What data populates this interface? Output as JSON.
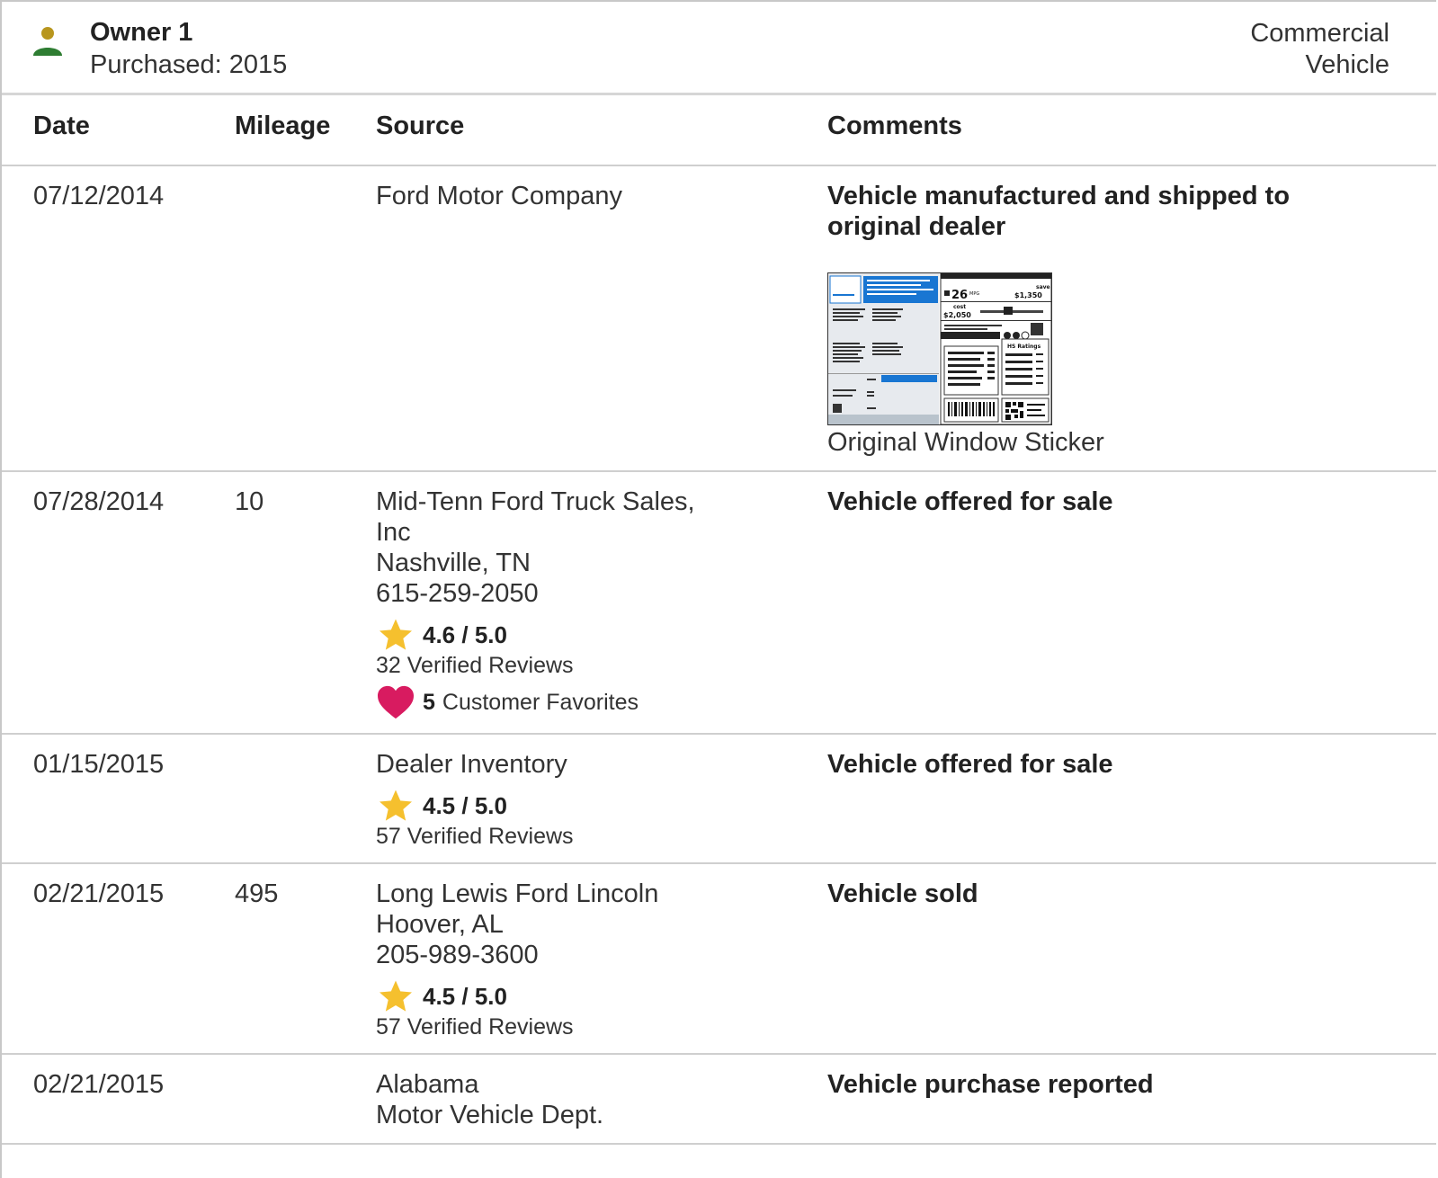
{
  "owner": {
    "name": "Owner 1",
    "purchased": "Purchased: 2015",
    "type_line1": "Commercial",
    "type_line2": "Vehicle"
  },
  "table": {
    "headers": {
      "date": "Date",
      "mileage": "Mileage",
      "source": "Source",
      "comments": "Comments"
    },
    "rows": [
      {
        "date": "07/12/2014",
        "mileage": "",
        "source": [
          "Ford Motor Company"
        ],
        "comment": "Vehicle manufactured and shipped to original dealer",
        "sticker_caption": "Original Window Sticker",
        "sticker": {
          "mpg": "26",
          "mpg_unit": "MPG",
          "save_label": "save",
          "save_value": "$1,350",
          "cost_label": "cost",
          "cost_value": "$2,050",
          "ratings_label": "HS Ratings"
        }
      },
      {
        "date": "07/28/2014",
        "mileage": "10",
        "source": [
          "Mid-Tenn Ford Truck Sales,",
          "Inc",
          "Nashville, TN",
          "615-259-2050"
        ],
        "rating": "4.6 / 5.0",
        "reviews": "32 Verified Reviews",
        "favorites_count": "5",
        "favorites_label": "Customer Favorites",
        "comment": "Vehicle offered for sale"
      },
      {
        "date": "01/15/2015",
        "mileage": "",
        "source": [
          "Dealer Inventory"
        ],
        "rating": "4.5 / 5.0",
        "reviews": "57 Verified Reviews",
        "comment": "Vehicle offered for sale"
      },
      {
        "date": "02/21/2015",
        "mileage": "495",
        "source": [
          "Long Lewis Ford Lincoln",
          "Hoover, AL",
          "205-989-3600"
        ],
        "rating": "4.5 / 5.0",
        "reviews": "57 Verified Reviews",
        "comment": "Vehicle sold"
      },
      {
        "date": "02/21/2015",
        "mileage": "",
        "source": [
          "Alabama",
          "Motor Vehicle Dept."
        ],
        "comment": "Vehicle purchase reported"
      }
    ]
  },
  "icons": {
    "owner": "person-icon",
    "rating": "star-icon",
    "favorite": "heart-icon"
  },
  "colors": {
    "owner_head": "#b8961e",
    "owner_body": "#2e7d32",
    "star": "#f5c02e",
    "heart": "#d81b60",
    "sticker_blue": "#1976d2"
  }
}
